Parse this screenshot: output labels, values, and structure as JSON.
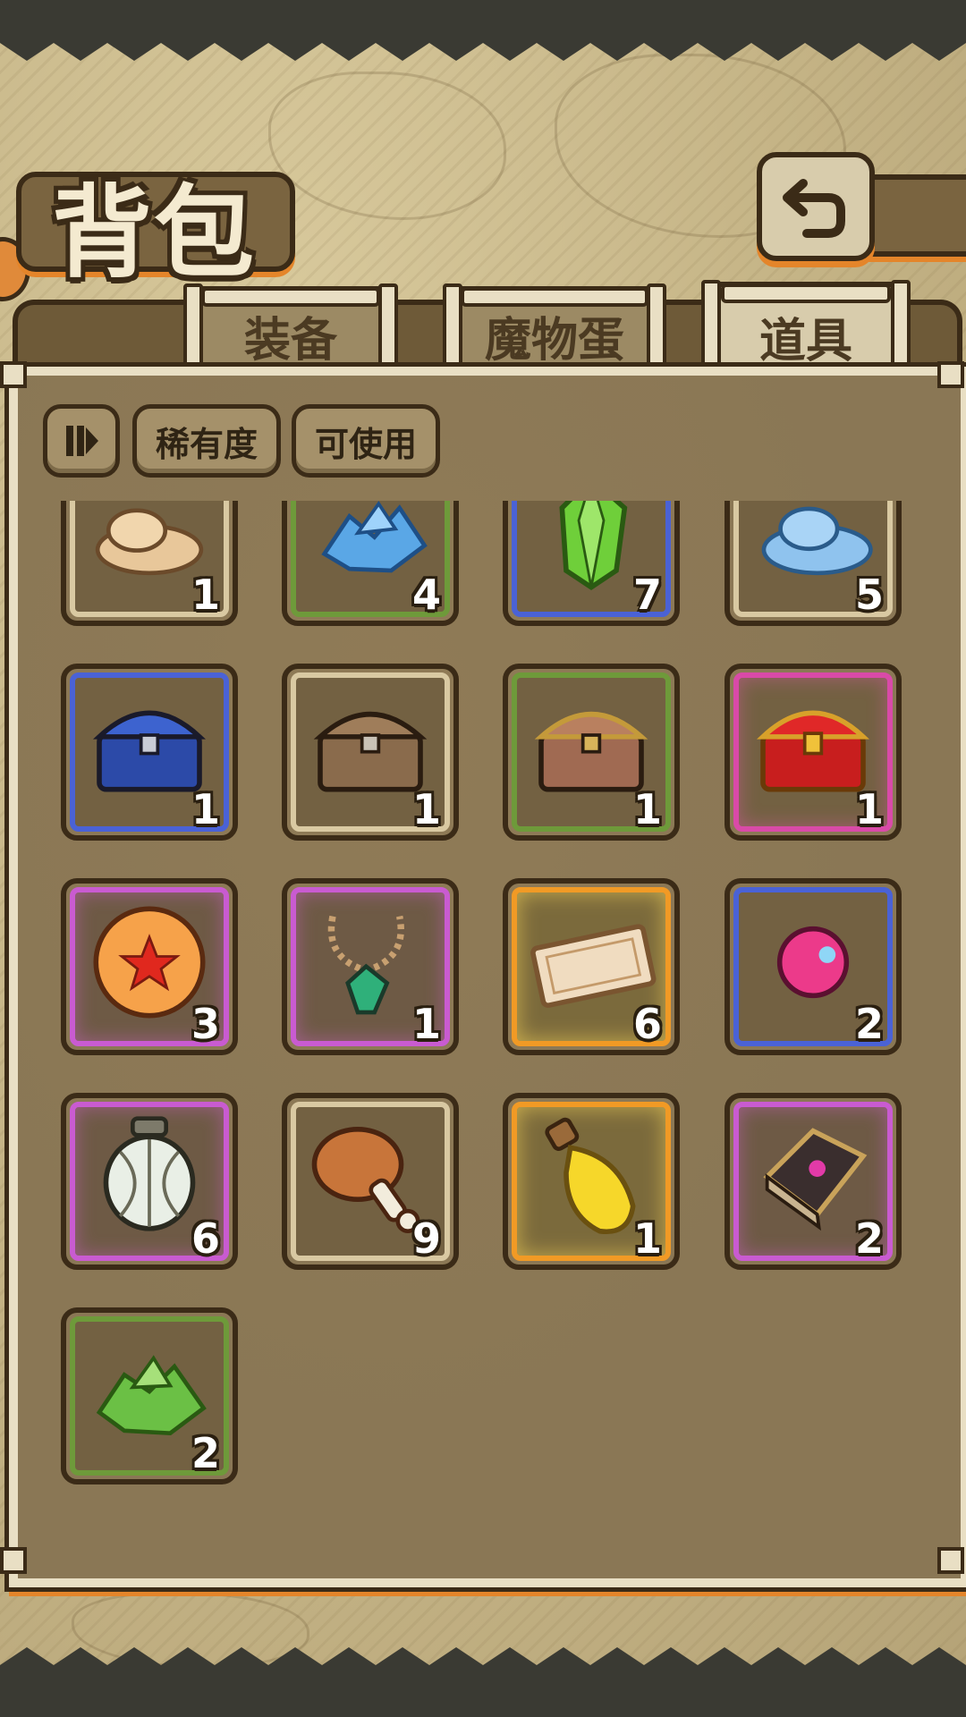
{
  "title": "背包",
  "tabs": [
    {
      "label": "装备",
      "active": false
    },
    {
      "label": "魔物蛋",
      "active": false
    },
    {
      "label": "道具",
      "active": true
    }
  ],
  "filters": {
    "sort_icon": "sort-toggle-icon",
    "rarity_label": "稀有度",
    "usable_label": "可使用"
  },
  "items": [
    {
      "icon": "sand-pile-icon",
      "count": "1",
      "rarity": "white"
    },
    {
      "icon": "blue-crystal-cluster-icon",
      "count": "4",
      "rarity": "green"
    },
    {
      "icon": "green-crystal-icon",
      "count": "7",
      "rarity": "blue"
    },
    {
      "icon": "blue-slime-pile-icon",
      "count": "5",
      "rarity": "white"
    },
    {
      "icon": "blue-treasure-chest-icon",
      "count": "1",
      "rarity": "blue"
    },
    {
      "icon": "wooden-chest-icon",
      "count": "1",
      "rarity": "white"
    },
    {
      "icon": "bronze-chest-icon",
      "count": "1",
      "rarity": "green"
    },
    {
      "icon": "red-treasure-chest-icon",
      "count": "1",
      "rarity": "red"
    },
    {
      "icon": "star-orb-icon",
      "count": "3",
      "rarity": "purple"
    },
    {
      "icon": "emerald-necklace-icon",
      "count": "1",
      "rarity": "purple"
    },
    {
      "icon": "ticket-icon",
      "count": "6",
      "rarity": "gold"
    },
    {
      "icon": "pink-gem-icon",
      "count": "2",
      "rarity": "blue"
    },
    {
      "icon": "lantern-icon",
      "count": "6",
      "rarity": "purple"
    },
    {
      "icon": "meat-drumstick-icon",
      "count": "9",
      "rarity": "white"
    },
    {
      "icon": "yellow-potion-icon",
      "count": "1",
      "rarity": "gold"
    },
    {
      "icon": "magic-book-icon",
      "count": "2",
      "rarity": "purple"
    },
    {
      "icon": "green-crystal-cluster-icon",
      "count": "2",
      "rarity": "green"
    }
  ],
  "colors": {
    "frame_dark": "#3b2b17",
    "panel": "#8a7755",
    "accent_orange": "#e4852a"
  }
}
